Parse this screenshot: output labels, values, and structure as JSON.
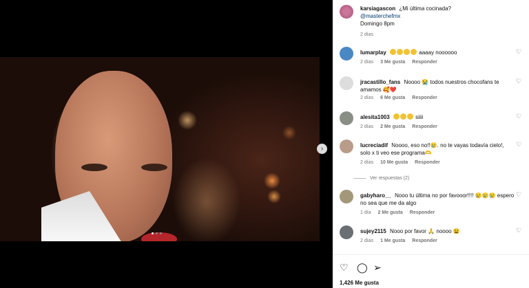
{
  "post": {
    "username": "karsiagascon",
    "caption": "¿Mi última cocinada?",
    "mention": "@masterchefmx",
    "schedule": "Domingo 8pm",
    "time": "2 días",
    "likes": "1,426 Me gusta"
  },
  "media": {
    "next_icon": "›"
  },
  "comments": [
    {
      "user": "lumarplay",
      "text": "aaaay noooooo",
      "time": "2 días",
      "likes": "3 Me gusta",
      "reply": "Responder"
    },
    {
      "user": "jracastillo_fans",
      "text": "Noooo 😭 todos nuestros chocofans te amamos 🥰❤️",
      "time": "2 días",
      "likes": "6 Me gusta",
      "reply": "Responder"
    },
    {
      "user": "alesita1003",
      "text": "siiii",
      "time": "2 días",
      "likes": "2 Me gusta",
      "reply": "Responder"
    },
    {
      "user": "lucreciadif",
      "text": "Noooo, eso no!!😢. no te vayas todavía cielo!, solo x ti veo ese programa🫶",
      "time": "2 días",
      "likes": "10 Me gusta",
      "reply": "Responder"
    },
    {
      "user": "gabyharo__",
      "text": "Nooo tu última no por favooor!!!! 😢😢😢 espero no sea que me da algo",
      "time": "1 día",
      "likes": "2 Me gusta",
      "reply": "Responder"
    },
    {
      "user": "sujey2115",
      "text": "Nooo por favor 🙏 noooo 😫",
      "time": "2 días",
      "likes": "1 Me gusta",
      "reply": "Responder"
    }
  ],
  "view_replies": "Ver respuestas (2)",
  "icons": {
    "heart": "heart-icon",
    "comment": "comment-icon",
    "share": "share-icon"
  }
}
